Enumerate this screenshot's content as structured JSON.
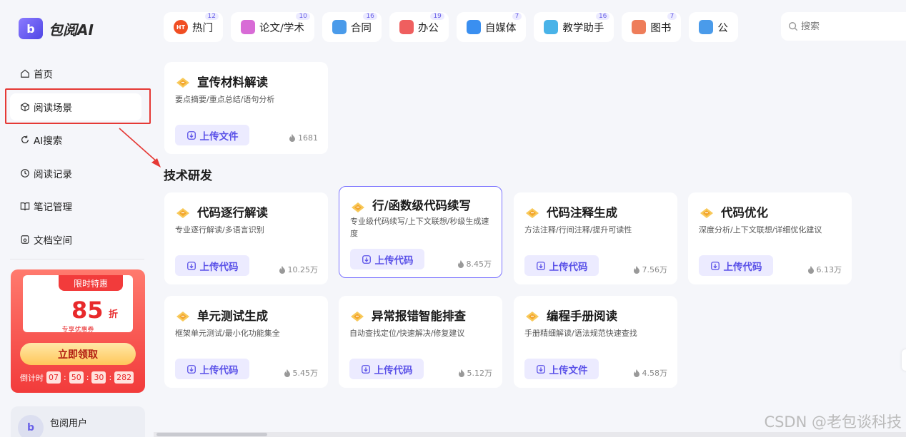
{
  "app": {
    "name": "包阅AI",
    "logo_letter": "b",
    "brand_color": "#5a51e8"
  },
  "sidebar": {
    "items": [
      {
        "label": "首页",
        "icon": "home-icon"
      },
      {
        "label": "阅读场景",
        "icon": "cube-icon",
        "active": true
      },
      {
        "label": "AI搜索",
        "icon": "refresh-search-icon"
      },
      {
        "label": "阅读记录",
        "icon": "clock-icon"
      },
      {
        "label": "笔记管理",
        "icon": "book-icon"
      },
      {
        "label": "文档空间",
        "icon": "doc-icon"
      }
    ],
    "promo": {
      "ribbon": "限时特惠",
      "number": "85",
      "unit": "折",
      "sub": "专享优惠券",
      "button": "立即领取",
      "countdown_label": "倒计时",
      "countdown": [
        "07",
        "50",
        "30",
        "282"
      ]
    },
    "user": {
      "avatar_letter": "b",
      "name": "包阅用户"
    }
  },
  "tabs": [
    {
      "label": "热门",
      "count": "12",
      "color": "#f04e23",
      "icon": "hot-icon"
    },
    {
      "label": "论文/学术",
      "count": "10",
      "color": "#d86bd6",
      "icon": "paper-icon"
    },
    {
      "label": "合同",
      "count": "16",
      "color": "#4a9bea",
      "icon": "contract-icon"
    },
    {
      "label": "办公",
      "count": "19",
      "color": "#ef5f5f",
      "icon": "office-icon"
    },
    {
      "label": "自媒体",
      "count": "7",
      "color": "#3a8ff0",
      "icon": "media-icon"
    },
    {
      "label": "教学助手",
      "count": "16",
      "color": "#49b3e8",
      "icon": "teach-icon"
    },
    {
      "label": "图书",
      "count": "7",
      "color": "#ee7d5a",
      "icon": "book-icon"
    },
    {
      "label": "公",
      "count": "",
      "color": "#4a9bea",
      "icon": "public-icon"
    }
  ],
  "search": {
    "placeholder": "搜索"
  },
  "top_card": {
    "title": "宣传材料解读",
    "desc": "要点摘要/重点总结/语句分析",
    "button": "上传文件",
    "count": "1681"
  },
  "section": {
    "title": "技术研发"
  },
  "cards": [
    {
      "title": "代码逐行解读",
      "desc": "专业逐行解读/多语言识别",
      "button": "上传代码",
      "count": "10.25万"
    },
    {
      "title": "行/函数级代码续写",
      "desc": "专业级代码续写/上下文联想/秒级生成速度",
      "button": "上传代码",
      "count": "8.45万",
      "selected": true
    },
    {
      "title": "代码注释生成",
      "desc": "方法注释/行间注释/提升可读性",
      "button": "上传代码",
      "count": "7.56万"
    },
    {
      "title": "代码优化",
      "desc": "深度分析/上下文联想/详细优化建议",
      "button": "上传代码",
      "count": "6.13万"
    },
    {
      "title": "单元测试生成",
      "desc": "框架单元测试/最小化功能集全",
      "button": "上传代码",
      "count": "5.45万"
    },
    {
      "title": "异常报错智能排查",
      "desc": "自动查找定位/快速解决/修复建议",
      "button": "上传代码",
      "count": "5.12万"
    },
    {
      "title": "编程手册阅读",
      "desc": "手册精细解读/语法规范快速查找",
      "button": "上传文件",
      "count": "4.58万"
    }
  ],
  "watermark": "CSDN @老包谈科技"
}
